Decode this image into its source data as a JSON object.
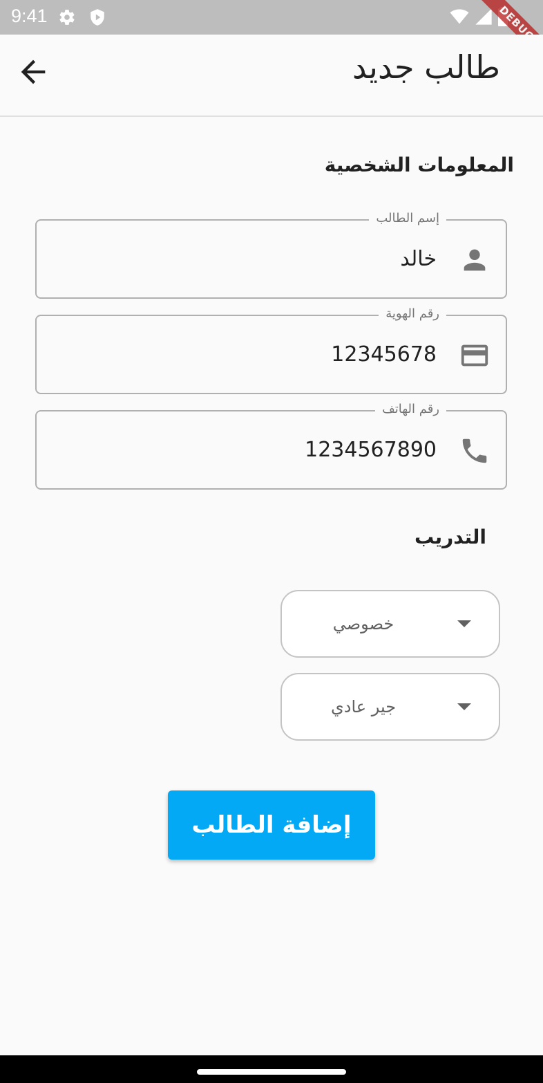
{
  "status_bar": {
    "time": "9:41",
    "debug_label": "DEBUG"
  },
  "app_bar": {
    "title": "طالب جديد",
    "back_icon": "arrow-back-icon"
  },
  "personal_info": {
    "section_title": "المعلومات الشخصية",
    "fields": [
      {
        "label": "إسم الطالب",
        "value": "خالد",
        "icon": "person-icon"
      },
      {
        "label": "رقم الهوية",
        "value": "12345678",
        "icon": "credit-card-icon"
      },
      {
        "label": "رقم الهاتف",
        "value": "1234567890",
        "icon": "phone-icon"
      }
    ]
  },
  "training": {
    "section_title": "التدريب",
    "dropdowns": [
      {
        "value": "خصوصي"
      },
      {
        "value": "جير عادي"
      }
    ]
  },
  "actions": {
    "add_student_label": "إضافة الطالب"
  },
  "colors": {
    "accent": "#03a9f4",
    "status_bar": "#bdbdbd",
    "debug_banner": "#b71c1c"
  }
}
